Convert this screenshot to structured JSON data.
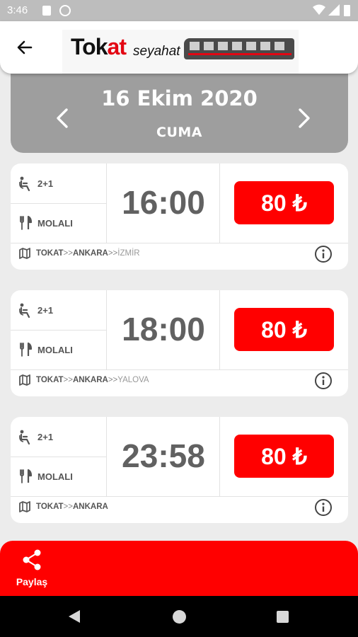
{
  "status_bar": {
    "time": "3:46"
  },
  "app_bar": {
    "logo": {
      "brand_primary": "Tok",
      "brand_accent": "at",
      "brand_secondary": "seyahat"
    }
  },
  "date_header": {
    "date": "16 Ekim 2020",
    "day": "CUMA"
  },
  "trips": [
    {
      "seat_layout": "2+1",
      "service": "MOLALI",
      "time": "16:00",
      "price": "80 ₺",
      "route": {
        "origin": "TOKAT",
        "middle": "ANKARA",
        "end": "İZMİR",
        "separator": ">>"
      }
    },
    {
      "seat_layout": "2+1",
      "service": "MOLALI",
      "time": "18:00",
      "price": "80 ₺",
      "route": {
        "origin": "TOKAT",
        "middle": "ANKARA",
        "end": "YALOVA",
        "separator": ">>"
      }
    },
    {
      "seat_layout": "2+1",
      "service": "MOLALI",
      "time": "23:58",
      "price": "80 ₺",
      "route": {
        "origin": "TOKAT",
        "middle": "ANKARA",
        "end": "",
        "separator": ">>"
      }
    }
  ],
  "share": {
    "label": "Paylaş"
  },
  "colors": {
    "accent": "#ff0000",
    "header_bg": "#9e9e9e",
    "page_bg": "#ececec",
    "time_text": "#616161"
  },
  "icons": [
    "back-arrow-icon",
    "chevron-left-icon",
    "chevron-right-icon",
    "seat-icon",
    "fork-knife-icon",
    "map-icon",
    "info-icon",
    "share-icon"
  ]
}
